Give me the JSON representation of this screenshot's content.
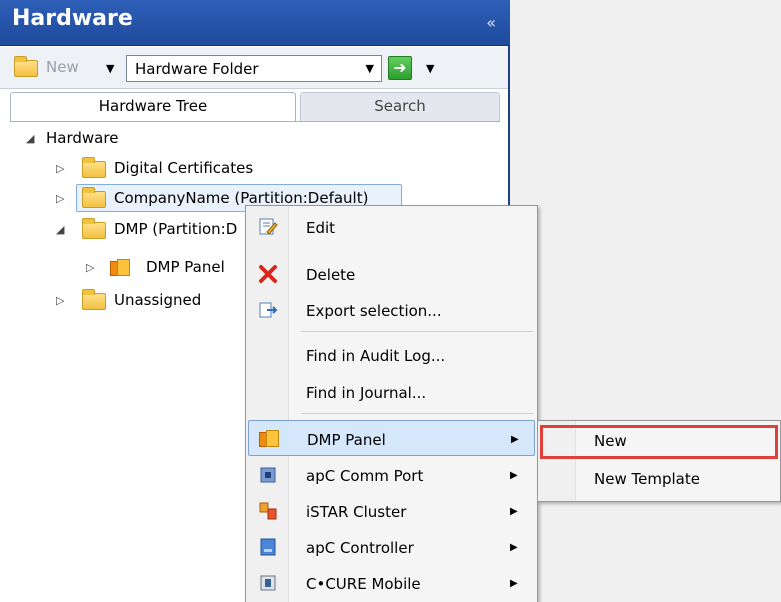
{
  "panel": {
    "title": "Hardware",
    "collapse_icon": "double-chevron-left-icon"
  },
  "toolbar": {
    "new_label": "New",
    "folder_select_value": "Hardware Folder"
  },
  "tabs": [
    {
      "label": "Hardware Tree",
      "active": true
    },
    {
      "label": "Search",
      "active": false
    }
  ],
  "tree": {
    "root": "Hardware",
    "items": [
      {
        "label": "Digital Certificates"
      },
      {
        "label": "CompanyName (Partition:Default)"
      },
      {
        "label": "DMP (Partition:D"
      },
      {
        "label": "DMP Panel"
      },
      {
        "label": "Unassigned"
      }
    ]
  },
  "context_menu": {
    "items": [
      {
        "label": "Edit",
        "icon": "edit-icon"
      },
      {
        "label": "Delete",
        "icon": "delete-x-icon"
      },
      {
        "label": "Export selection...",
        "icon": "export-icon"
      },
      {
        "label": "Find in Audit Log..."
      },
      {
        "label": "Find in Journal..."
      },
      {
        "label": "DMP Panel",
        "icon": "dmp-panel-icon",
        "has_submenu": true
      },
      {
        "label": "apC Comm Port",
        "icon": "comm-port-icon",
        "has_submenu": true
      },
      {
        "label": "iSTAR Cluster",
        "icon": "cluster-icon",
        "has_submenu": true
      },
      {
        "label": "apC Controller",
        "icon": "controller-icon",
        "has_submenu": true
      },
      {
        "label": "C•CURE Mobile",
        "icon": "mobile-icon",
        "has_submenu": true
      }
    ]
  },
  "submenu": {
    "items": [
      {
        "label": "New"
      },
      {
        "label": "New Template"
      }
    ]
  },
  "colors": {
    "header_blue": "#2556ad",
    "menu_highlight": "#d5e7fb",
    "focus_red": "#e0403a"
  }
}
